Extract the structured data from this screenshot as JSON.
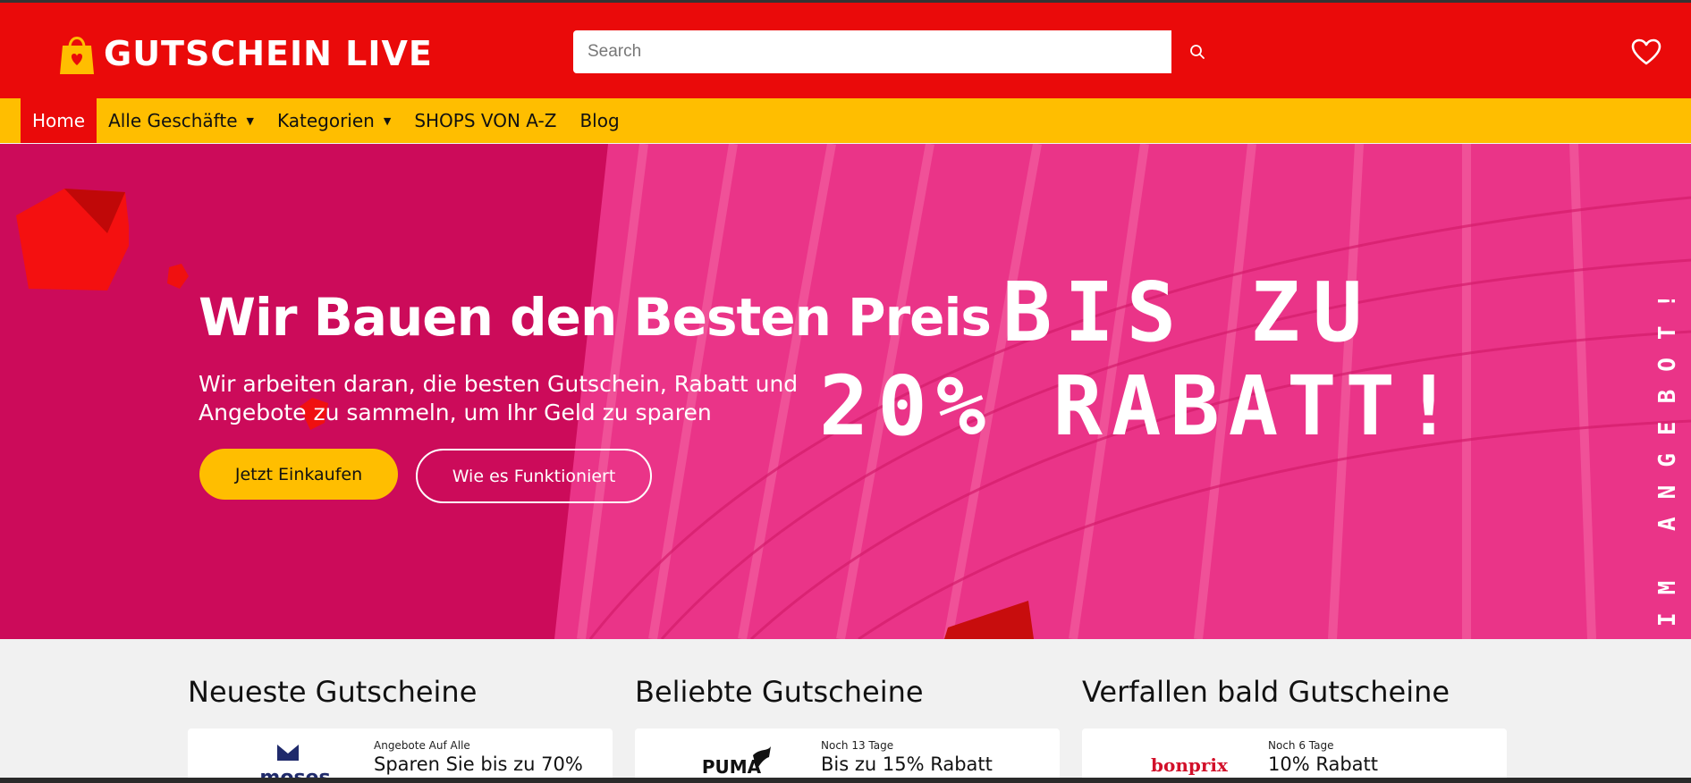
{
  "header": {
    "logo_text": "GUTSCHEIN LIVE",
    "search_placeholder": "Search"
  },
  "nav": {
    "items": [
      {
        "label": "Home",
        "active": true
      },
      {
        "label": "Alle Geschäfte",
        "dropdown": true
      },
      {
        "label": "Kategorien",
        "dropdown": true
      },
      {
        "label": "SHOPS VON A-Z"
      },
      {
        "label": "Blog"
      }
    ]
  },
  "hero": {
    "title": "Wir Bauen den Besten Preis",
    "subtitle": "Wir arbeiten daran, die besten Gutschein, Rabatt und Angebote zu sammeln, um Ihr Geld zu sparen",
    "promo_line1": "BIS ZU",
    "promo_line2": "20% RABATT!",
    "vertical_text": "IM ANGEBOT!",
    "primary_button": "Jetzt Einkaufen",
    "secondary_button": "Wie es Funktioniert"
  },
  "sections": [
    {
      "title": "Neueste Gutscheine",
      "card": {
        "logo": "moses",
        "tag": "Angebote Auf Alle",
        "title": "Sparen Sie bis zu 70%"
      }
    },
    {
      "title": "Beliebte Gutscheine",
      "card": {
        "logo": "PUMA",
        "tag": "Noch 13 Tage",
        "title": "Bis zu 15% Rabatt"
      }
    },
    {
      "title": "Verfallen bald Gutscheine",
      "card": {
        "logo": "bonprix",
        "tag": "Noch 6 Tage",
        "title": "10% Rabatt"
      }
    }
  ],
  "colors": {
    "header_red": "#ea0a0a",
    "nav_yellow": "#ffbe00",
    "hero_magenta": "#cc0b5a"
  }
}
